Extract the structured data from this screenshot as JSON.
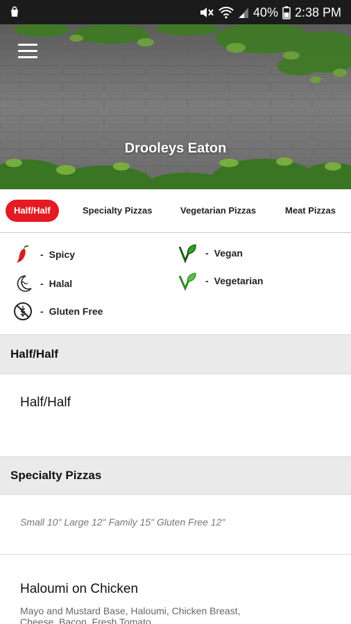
{
  "status_bar": {
    "battery": "40%",
    "time": "2:38 PM"
  },
  "header": {
    "title": "Drooleys Eaton"
  },
  "tabs": [
    {
      "label": "Half/Half",
      "active": true
    },
    {
      "label": "Specialty Pizzas",
      "active": false
    },
    {
      "label": "Vegetarian Pizzas",
      "active": false
    },
    {
      "label": "Meat Pizzas",
      "active": false
    }
  ],
  "legend": {
    "spicy": "Spicy",
    "halal": "Halal",
    "gluten_free": "Gluten Free",
    "vegan": "Vegan",
    "vegetarian": "Vegetarian",
    "dash": "-"
  },
  "sections": [
    {
      "title": "Half/Half",
      "items": [
        {
          "name": "Half/Half"
        }
      ]
    },
    {
      "title": "Specialty Pizzas",
      "note": "Small 10\" Large 12\" Family 15\" Gluten Free 12\"",
      "items": [
        {
          "name": "Haloumi on Chicken",
          "description": "Mayo and Mustard Base, Haloumi, Chicken Breast, Cheese, Bacon, Fresh Tomato"
        }
      ]
    }
  ],
  "colors": {
    "accent": "#e31b23",
    "statusbar": "#1b1b1b",
    "section_bg": "#eaeaea",
    "vegan_green": "#2e9e2a"
  }
}
